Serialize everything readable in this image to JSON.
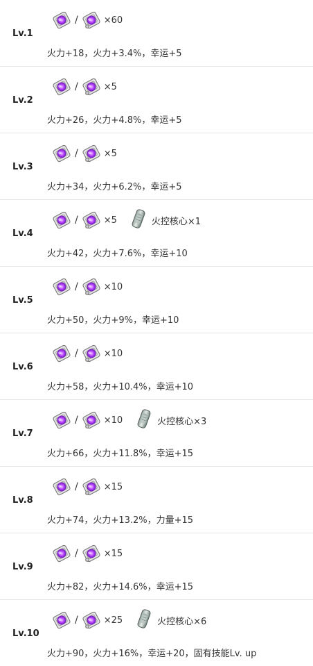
{
  "material_separator": "/",
  "levels": [
    {
      "level": "Lv.1",
      "count": "×60",
      "core": "",
      "stats": "火力+18，火力+3.4%，幸运+5"
    },
    {
      "level": "Lv.2",
      "count": "×5",
      "core": "",
      "stats": "火力+26，火力+4.8%，幸运+5"
    },
    {
      "level": "Lv.3",
      "count": "×5",
      "core": "",
      "stats": "火力+34，火力+6.2%，幸运+5"
    },
    {
      "level": "Lv.4",
      "count": "×5",
      "core": "火控核心×1",
      "stats": "火力+42，火力+7.6%，幸运+10"
    },
    {
      "level": "Lv.5",
      "count": "×10",
      "core": "",
      "stats": "火力+50，火力+9%，幸运+10"
    },
    {
      "level": "Lv.6",
      "count": "×10",
      "core": "",
      "stats": "火力+58，火力+10.4%，幸运+10"
    },
    {
      "level": "Lv.7",
      "count": "×10",
      "core": "火控核心×3",
      "stats": "火力+66，火力+11.8%，幸运+15"
    },
    {
      "level": "Lv.8",
      "count": "×15",
      "core": "",
      "stats": "火力+74，火力+13.2%，力量+15"
    },
    {
      "level": "Lv.9",
      "count": "×15",
      "core": "",
      "stats": "火力+82，火力+14.6%，幸运+15"
    },
    {
      "level": "Lv.10",
      "count": "×25",
      "core": "火控核心×6",
      "stats": "火力+90，火力+16%，幸运+20，固有技能Lv. up"
    }
  ],
  "icons": {
    "material_a": "purple-chip-icon",
    "material_b": "purple-chip-variant-icon",
    "core": "fire-control-core-icon"
  }
}
